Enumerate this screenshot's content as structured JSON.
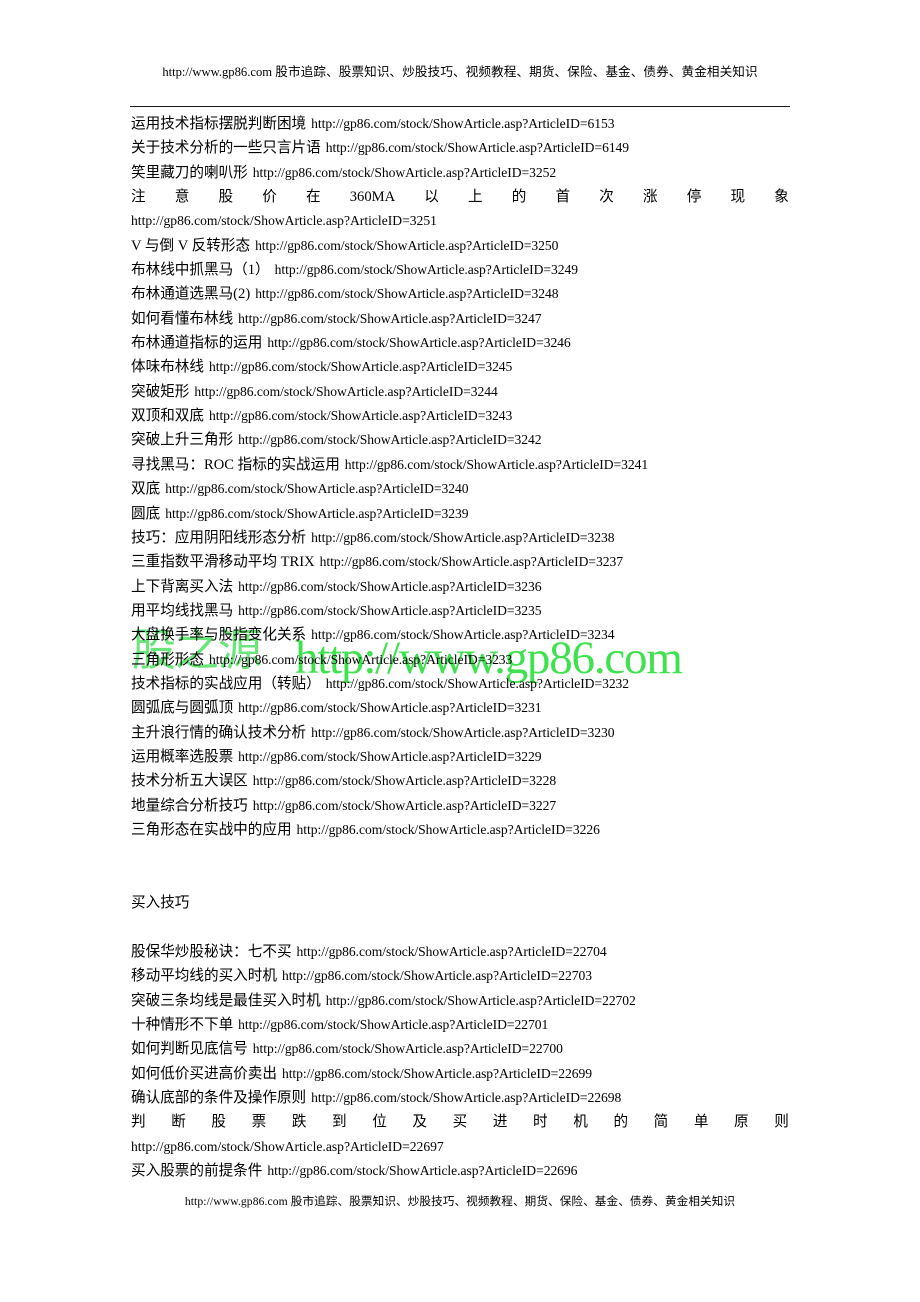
{
  "header": {
    "site_url": "http://www.gp86.com",
    "description": "股市追踪、股票知识、炒股技巧、视频教程、期货、保险、基金、债券、黄金相关知识"
  },
  "footer": {
    "site_url": "http://www.gp86.com",
    "description": "股市追踪、股票知识、炒股技巧、视频教程、期货、保险、基金、债券、黄金相关知识"
  },
  "watermark": {
    "brand": "股之源",
    "url": "http://www.gp86.com",
    "color_cn": "#49e05c",
    "color_url": "#2ee03f"
  },
  "sections": [
    {
      "heading": "",
      "entries": [
        {
          "title": "运用技术指标摆脱判断困境",
          "url": "http://gp86.com/stock/ShowArticle.asp?ArticleID=6153",
          "justified": false
        },
        {
          "title": "关于技术分析的一些只言片语",
          "url": "http://gp86.com/stock/ShowArticle.asp?ArticleID=6149",
          "justified": false
        },
        {
          "title": "笑里藏刀的喇叭形",
          "url": "http://gp86.com/stock/ShowArticle.asp?ArticleID=3252",
          "justified": false
        },
        {
          "title": "注意股价在 360MA 以上的首次涨停现象",
          "url": "http://gp86.com/stock/ShowArticle.asp?ArticleID=3251",
          "justified": true,
          "justified_cells": [
            "注",
            "意",
            "股",
            "价",
            "在",
            "360MA",
            "以",
            "上",
            "的",
            "首",
            "次",
            "涨",
            "停",
            "现",
            "象"
          ]
        },
        {
          "title": "V 与倒 V 反转形态",
          "url": "http://gp86.com/stock/ShowArticle.asp?ArticleID=3250",
          "justified": false
        },
        {
          "title": "布林线中抓黑马（1）",
          "url": "http://gp86.com/stock/ShowArticle.asp?ArticleID=3249",
          "justified": false
        },
        {
          "title": "布林通道选黑马(2)",
          "url": "http://gp86.com/stock/ShowArticle.asp?ArticleID=3248",
          "justified": false
        },
        {
          "title": "如何看懂布林线",
          "url": "http://gp86.com/stock/ShowArticle.asp?ArticleID=3247",
          "justified": false
        },
        {
          "title": "布林通道指标的运用",
          "url": "http://gp86.com/stock/ShowArticle.asp?ArticleID=3246",
          "justified": false
        },
        {
          "title": "体味布林线",
          "url": "http://gp86.com/stock/ShowArticle.asp?ArticleID=3245",
          "justified": false
        },
        {
          "title": "突破矩形",
          "url": "http://gp86.com/stock/ShowArticle.asp?ArticleID=3244",
          "justified": false
        },
        {
          "title": "双顶和双底",
          "url": "http://gp86.com/stock/ShowArticle.asp?ArticleID=3243",
          "justified": false
        },
        {
          "title": "突破上升三角形",
          "url": "http://gp86.com/stock/ShowArticle.asp?ArticleID=3242",
          "justified": false
        },
        {
          "title": "寻找黑马：ROC 指标的实战运用",
          "url": "http://gp86.com/stock/ShowArticle.asp?ArticleID=3241",
          "justified": false
        },
        {
          "title": "双底",
          "url": "http://gp86.com/stock/ShowArticle.asp?ArticleID=3240",
          "justified": false
        },
        {
          "title": "圆底",
          "url": "http://gp86.com/stock/ShowArticle.asp?ArticleID=3239",
          "justified": false
        },
        {
          "title": "技巧：应用阴阳线形态分析",
          "url": "http://gp86.com/stock/ShowArticle.asp?ArticleID=3238",
          "justified": false
        },
        {
          "title": "三重指数平滑移动平均 TRIX",
          "url": "http://gp86.com/stock/ShowArticle.asp?ArticleID=3237",
          "justified": false
        },
        {
          "title": "上下背离买入法",
          "url": "http://gp86.com/stock/ShowArticle.asp?ArticleID=3236",
          "justified": false
        },
        {
          "title": "用平均线找黑马",
          "url": "http://gp86.com/stock/ShowArticle.asp?ArticleID=3235",
          "justified": false
        },
        {
          "title": "大盘换手率与股指变化关系",
          "url": "http://gp86.com/stock/ShowArticle.asp?ArticleID=3234",
          "justified": false
        },
        {
          "title": "三角形形态",
          "url": "http://gp86.com/stock/ShowArticle.asp?ArticleID=3233",
          "justified": false
        },
        {
          "title": "技术指标的实战应用（转贴）",
          "url": "http://gp86.com/stock/ShowArticle.asp?ArticleID=3232",
          "justified": false
        },
        {
          "title": "圆弧底与圆弧顶",
          "url": "http://gp86.com/stock/ShowArticle.asp?ArticleID=3231",
          "justified": false
        },
        {
          "title": "主升浪行情的确认技术分析",
          "url": "http://gp86.com/stock/ShowArticle.asp?ArticleID=3230",
          "justified": false
        },
        {
          "title": "运用概率选股票",
          "url": "http://gp86.com/stock/ShowArticle.asp?ArticleID=3229",
          "justified": false
        },
        {
          "title": "技术分析五大误区",
          "url": "http://gp86.com/stock/ShowArticle.asp?ArticleID=3228",
          "justified": false
        },
        {
          "title": "地量综合分析技巧",
          "url": "http://gp86.com/stock/ShowArticle.asp?ArticleID=3227",
          "justified": false
        },
        {
          "title": "三角形态在实战中的应用",
          "url": "http://gp86.com/stock/ShowArticle.asp?ArticleID=3226",
          "justified": false
        }
      ]
    },
    {
      "heading": "买入技巧",
      "entries": [
        {
          "title": "股保华炒股秘诀：七不买",
          "url": "http://gp86.com/stock/ShowArticle.asp?ArticleID=22704",
          "justified": false
        },
        {
          "title": "移动平均线的买入时机",
          "url": "http://gp86.com/stock/ShowArticle.asp?ArticleID=22703",
          "justified": false
        },
        {
          "title": "突破三条均线是最佳买入时机",
          "url": "http://gp86.com/stock/ShowArticle.asp?ArticleID=22702",
          "justified": false
        },
        {
          "title": "十种情形不下单",
          "url": "http://gp86.com/stock/ShowArticle.asp?ArticleID=22701",
          "justified": false
        },
        {
          "title": "如何判断见底信号",
          "url": "http://gp86.com/stock/ShowArticle.asp?ArticleID=22700",
          "justified": false
        },
        {
          "title": "如何低价买进高价卖出",
          "url": "http://gp86.com/stock/ShowArticle.asp?ArticleID=22699",
          "justified": false
        },
        {
          "title": "确认底部的条件及操作原则",
          "url": "http://gp86.com/stock/ShowArticle.asp?ArticleID=22698",
          "justified": false
        },
        {
          "title": "判断股票跌到位及买进时机的简单原则",
          "url": "http://gp86.com/stock/ShowArticle.asp?ArticleID=22697",
          "justified": true,
          "justified_cells": [
            "判",
            "断",
            "股",
            "票",
            "跌",
            "到",
            "位",
            "及",
            "买",
            "进",
            "时",
            "机",
            "的",
            "简",
            "单",
            "原",
            "则"
          ]
        },
        {
          "title": "买入股票的前提条件",
          "url": "http://gp86.com/stock/ShowArticle.asp?ArticleID=22696",
          "justified": false
        }
      ]
    }
  ]
}
